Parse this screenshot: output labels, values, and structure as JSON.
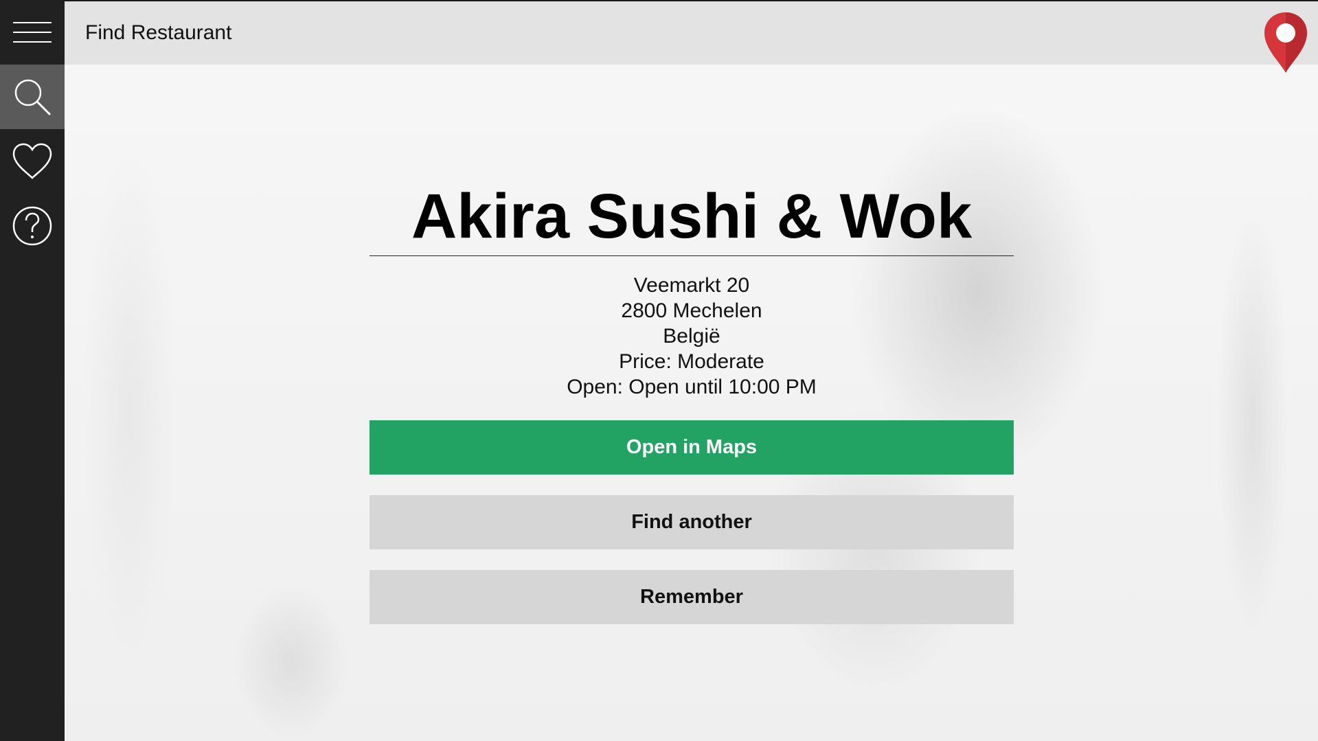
{
  "topbar": {
    "title": "Find Restaurant"
  },
  "sidebar": {
    "items": [
      {
        "icon": "menu-icon",
        "active": false
      },
      {
        "icon": "search-icon",
        "active": true
      },
      {
        "icon": "heart-icon",
        "active": false
      },
      {
        "icon": "help-icon",
        "active": false
      }
    ]
  },
  "restaurant": {
    "name": "Akira Sushi & Wok",
    "street": "Veemarkt 20",
    "city": "2800 Mechelen",
    "country": "België",
    "price": "Price: Moderate",
    "open": "Open: Open until 10:00 PM"
  },
  "actions": {
    "open_maps": "Open in Maps",
    "find_another": "Find another",
    "remember": "Remember"
  },
  "colors": {
    "sidebar": "#212121",
    "sidebar_active": "#5a5a5a",
    "topbar": "#e3e3e3",
    "primary": "#22a363",
    "secondary": "#d6d6d6",
    "pin": "#d6353b"
  }
}
